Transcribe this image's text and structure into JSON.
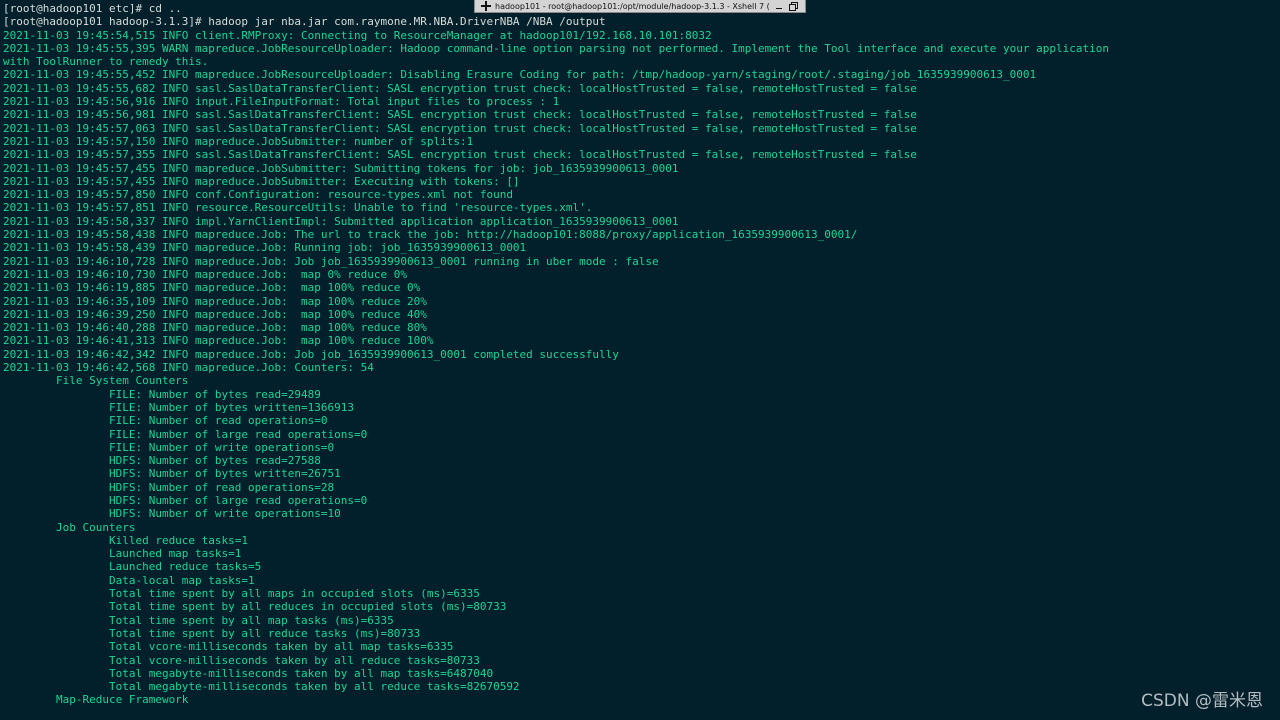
{
  "window": {
    "title": "hadoop101 - root@hadoop101:/opt/module/hadoop-3.1.3 - Xshell 7 (",
    "tab_icon": "plus-icon",
    "controls": [
      "minimize-icon",
      "restore-icon"
    ]
  },
  "colors": {
    "background": "#01202b",
    "log_text": "#1fd494",
    "prompt_text": "#d8dcd8"
  },
  "terminal_lines": [
    {
      "kind": "prompt",
      "text": "[root@hadoop101 etc]# cd .."
    },
    {
      "kind": "prompt",
      "text": "[root@hadoop101 hadoop-3.1.3]# hadoop jar nba.jar com.raymone.MR.NBA.DriverNBA /NBA /output"
    },
    {
      "kind": "log",
      "text": "2021-11-03 19:45:54,515 INFO client.RMProxy: Connecting to ResourceManager at hadoop101/192.168.10.101:8032"
    },
    {
      "kind": "log",
      "text": "2021-11-03 19:45:55,395 WARN mapreduce.JobResourceUploader: Hadoop command-line option parsing not performed. Implement the Tool interface and execute your application"
    },
    {
      "kind": "log",
      "text": "with ToolRunner to remedy this."
    },
    {
      "kind": "log",
      "text": "2021-11-03 19:45:55,452 INFO mapreduce.JobResourceUploader: Disabling Erasure Coding for path: /tmp/hadoop-yarn/staging/root/.staging/job_1635939900613_0001"
    },
    {
      "kind": "log",
      "text": "2021-11-03 19:45:55,682 INFO sasl.SaslDataTransferClient: SASL encryption trust check: localHostTrusted = false, remoteHostTrusted = false"
    },
    {
      "kind": "log",
      "text": "2021-11-03 19:45:56,916 INFO input.FileInputFormat: Total input files to process : 1"
    },
    {
      "kind": "log",
      "text": "2021-11-03 19:45:56,981 INFO sasl.SaslDataTransferClient: SASL encryption trust check: localHostTrusted = false, remoteHostTrusted = false"
    },
    {
      "kind": "log",
      "text": "2021-11-03 19:45:57,063 INFO sasl.SaslDataTransferClient: SASL encryption trust check: localHostTrusted = false, remoteHostTrusted = false"
    },
    {
      "kind": "log",
      "text": "2021-11-03 19:45:57,150 INFO mapreduce.JobSubmitter: number of splits:1"
    },
    {
      "kind": "log",
      "text": "2021-11-03 19:45:57,355 INFO sasl.SaslDataTransferClient: SASL encryption trust check: localHostTrusted = false, remoteHostTrusted = false"
    },
    {
      "kind": "log",
      "text": "2021-11-03 19:45:57,455 INFO mapreduce.JobSubmitter: Submitting tokens for job: job_1635939900613_0001"
    },
    {
      "kind": "log",
      "text": "2021-11-03 19:45:57,455 INFO mapreduce.JobSubmitter: Executing with tokens: []"
    },
    {
      "kind": "log",
      "text": "2021-11-03 19:45:57,850 INFO conf.Configuration: resource-types.xml not found"
    },
    {
      "kind": "log",
      "text": "2021-11-03 19:45:57,851 INFO resource.ResourceUtils: Unable to find 'resource-types.xml'."
    },
    {
      "kind": "log",
      "text": "2021-11-03 19:45:58,337 INFO impl.YarnClientImpl: Submitted application application_1635939900613_0001"
    },
    {
      "kind": "log",
      "text": "2021-11-03 19:45:58,438 INFO mapreduce.Job: The url to track the job: http://hadoop101:8088/proxy/application_1635939900613_0001/"
    },
    {
      "kind": "log",
      "text": "2021-11-03 19:45:58,439 INFO mapreduce.Job: Running job: job_1635939900613_0001"
    },
    {
      "kind": "log",
      "text": "2021-11-03 19:46:10,728 INFO mapreduce.Job: Job job_1635939900613_0001 running in uber mode : false"
    },
    {
      "kind": "log",
      "text": "2021-11-03 19:46:10,730 INFO mapreduce.Job:  map 0% reduce 0%"
    },
    {
      "kind": "log",
      "text": "2021-11-03 19:46:19,885 INFO mapreduce.Job:  map 100% reduce 0%"
    },
    {
      "kind": "log",
      "text": "2021-11-03 19:46:35,109 INFO mapreduce.Job:  map 100% reduce 20%"
    },
    {
      "kind": "log",
      "text": "2021-11-03 19:46:39,250 INFO mapreduce.Job:  map 100% reduce 40%"
    },
    {
      "kind": "log",
      "text": "2021-11-03 19:46:40,288 INFO mapreduce.Job:  map 100% reduce 80%"
    },
    {
      "kind": "log",
      "text": "2021-11-03 19:46:41,313 INFO mapreduce.Job:  map 100% reduce 100%"
    },
    {
      "kind": "log",
      "text": "2021-11-03 19:46:42,342 INFO mapreduce.Job: Job job_1635939900613_0001 completed successfully"
    },
    {
      "kind": "log",
      "text": "2021-11-03 19:46:42,568 INFO mapreduce.Job: Counters: 54"
    },
    {
      "kind": "stat",
      "text": "        File System Counters"
    },
    {
      "kind": "stat",
      "text": "                FILE: Number of bytes read=29489"
    },
    {
      "kind": "stat",
      "text": "                FILE: Number of bytes written=1366913"
    },
    {
      "kind": "stat",
      "text": "                FILE: Number of read operations=0"
    },
    {
      "kind": "stat",
      "text": "                FILE: Number of large read operations=0"
    },
    {
      "kind": "stat",
      "text": "                FILE: Number of write operations=0"
    },
    {
      "kind": "stat",
      "text": "                HDFS: Number of bytes read=27588"
    },
    {
      "kind": "stat",
      "text": "                HDFS: Number of bytes written=26751"
    },
    {
      "kind": "stat",
      "text": "                HDFS: Number of read operations=28"
    },
    {
      "kind": "stat",
      "text": "                HDFS: Number of large read operations=0"
    },
    {
      "kind": "stat",
      "text": "                HDFS: Number of write operations=10"
    },
    {
      "kind": "stat",
      "text": "        Job Counters"
    },
    {
      "kind": "stat",
      "text": "                Killed reduce tasks=1"
    },
    {
      "kind": "stat",
      "text": "                Launched map tasks=1"
    },
    {
      "kind": "stat",
      "text": "                Launched reduce tasks=5"
    },
    {
      "kind": "stat",
      "text": "                Data-local map tasks=1"
    },
    {
      "kind": "stat",
      "text": "                Total time spent by all maps in occupied slots (ms)=6335"
    },
    {
      "kind": "stat",
      "text": "                Total time spent by all reduces in occupied slots (ms)=80733"
    },
    {
      "kind": "stat",
      "text": "                Total time spent by all map tasks (ms)=6335"
    },
    {
      "kind": "stat",
      "text": "                Total time spent by all reduce tasks (ms)=80733"
    },
    {
      "kind": "stat",
      "text": "                Total vcore-milliseconds taken by all map tasks=6335"
    },
    {
      "kind": "stat",
      "text": "                Total vcore-milliseconds taken by all reduce tasks=80733"
    },
    {
      "kind": "stat",
      "text": "                Total megabyte-milliseconds taken by all map tasks=6487040"
    },
    {
      "kind": "stat",
      "text": "                Total megabyte-milliseconds taken by all reduce tasks=82670592"
    },
    {
      "kind": "stat",
      "text": "        Map-Reduce Framework"
    }
  ],
  "watermark": "CSDN @雷米恩"
}
